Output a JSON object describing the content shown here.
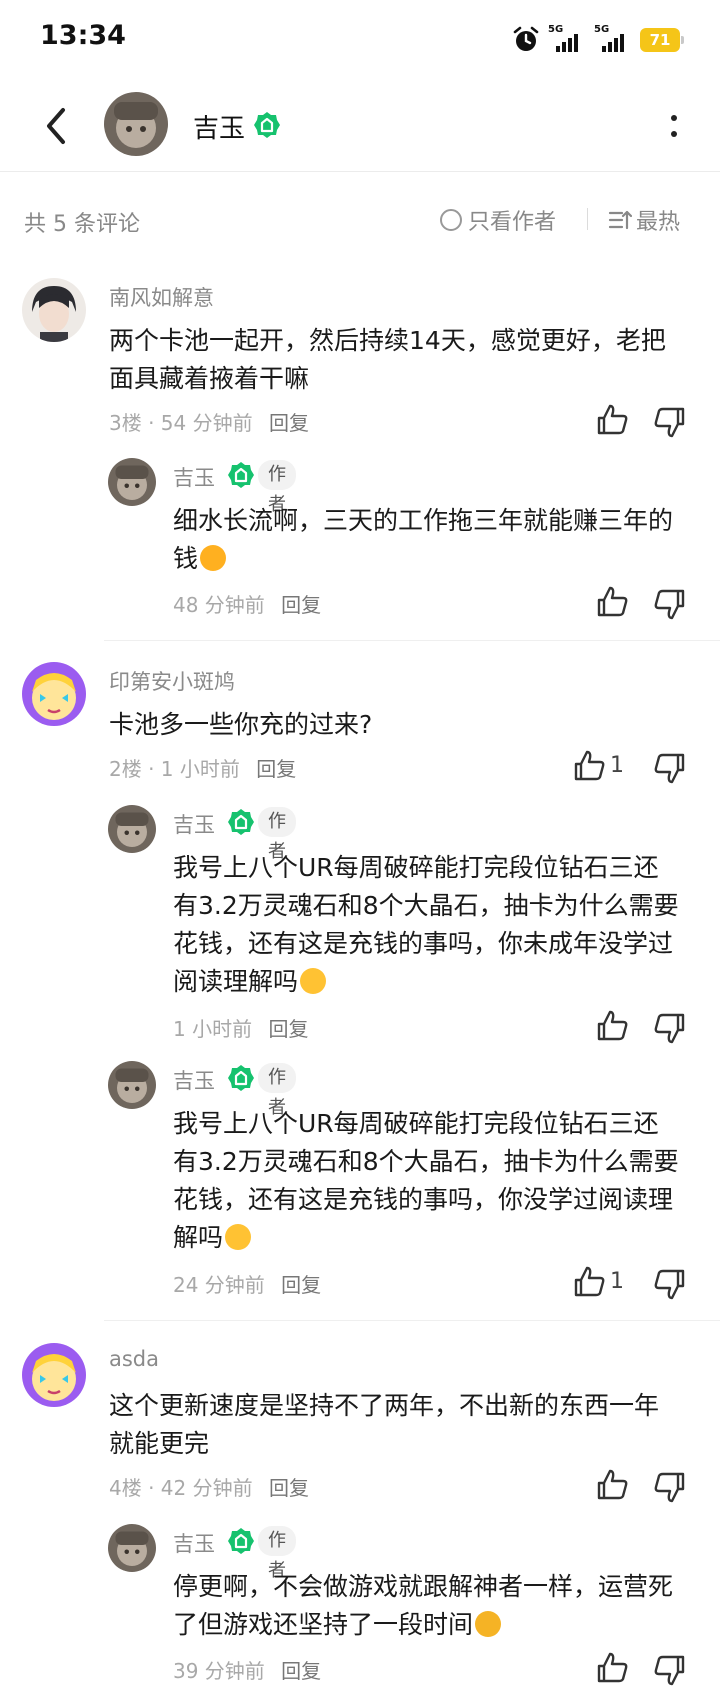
{
  "status": {
    "time": "13:34",
    "net1": "5G",
    "net2": "5G",
    "battery": "71"
  },
  "header": {
    "name": "吉玉"
  },
  "filter": {
    "count_label": "共 5 条评论",
    "author_only": "只看作者",
    "sort_label": "最热"
  },
  "comments": [
    {
      "user": "南风如解意",
      "text": "两个卡池一起开，然后持续14天，感觉更好，老把面具藏着掖着干嘛",
      "meta": "3楼 · 54 分钟前",
      "reply_label": "回复",
      "replies": [
        {
          "user": "吉玉",
          "tag": "作者",
          "text": "细水长流啊，三天的工作拖三年就能赚三年的钱",
          "meta": "48 分钟前",
          "reply_label": "回复"
        }
      ]
    },
    {
      "user": "印第安小斑鸠",
      "text": "卡池多一些你充的过来?",
      "meta": "2楼 · 1 小时前",
      "reply_label": "回复",
      "likes": "1",
      "replies": [
        {
          "user": "吉玉",
          "tag": "作者",
          "text": "我号上八个UR每周破碎能打完段位钻石三还有3.2万灵魂石和8个大晶石，抽卡为什么需要花钱，还有这是充钱的事吗，你未成年没学过阅读理解吗",
          "meta": "1 小时前",
          "reply_label": "回复"
        },
        {
          "user": "吉玉",
          "tag": "作者",
          "text": "我号上八个UR每周破碎能打完段位钻石三还有3.2万灵魂石和8个大晶石，抽卡为什么需要花钱，还有这是充钱的事吗，你没学过阅读理解吗",
          "meta": "24 分钟前",
          "reply_label": "回复",
          "likes": "1"
        }
      ]
    },
    {
      "user": "asda",
      "text": "这个更新速度是坚持不了两年，不出新的东西一年就能更完",
      "meta": "4楼 · 42 分钟前",
      "reply_label": "回复",
      "replies": [
        {
          "user": "吉玉",
          "tag": "作者",
          "text": "停更啊，不会做游戏就跟解神者一样，运营死了但游戏还坚持了一段时间",
          "meta": "39 分钟前",
          "reply_label": "回复"
        }
      ]
    }
  ]
}
